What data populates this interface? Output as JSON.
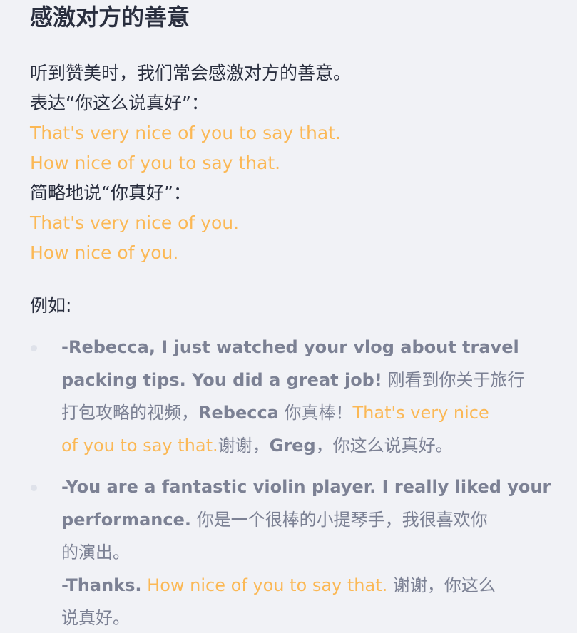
{
  "title": "感激对方的善意",
  "intro": {
    "line1": "听到赞美时，我们常会感激对方的善意。",
    "line2": "表达“你这么说真好”：",
    "phrase1": "That's very nice of you to say that.",
    "phrase2": "How nice of you to say that.",
    "line3": "简略地说“你真好”：",
    "phrase3": "That's very nice of you.",
    "phrase4": "How nice of you."
  },
  "example_label": "例如:",
  "examples": [
    {
      "en_l1": "-Rebecca, I just watched your vlog about travel",
      "en_l2": "packing tips. You did a great job!",
      "zh_l2": " 刚看到你关于旅行",
      "zh_l3a": "打包攻略的视频，",
      "en_l3": "Rebecca",
      "zh_l3b": " 你真棒！",
      "hl_l3": "That's very nice",
      "hl_l4": "of you to say that.",
      "zh_l4a": "谢谢，",
      "en_l4": "Greg",
      "zh_l4b": "，你这么说真好。"
    },
    {
      "en_l1": "-You are a fantastic violin player. I really liked your",
      "en_l2": "performance.",
      "zh_l2": " 你是一个很棒的小提琴手，我很喜欢你",
      "zh_l3": "的演出。",
      "en_l4": "-Thanks.",
      "hl_l4": " How nice of you to say that.",
      "zh_l4": " 谢谢，你这么",
      "zh_l5": "说真好。"
    }
  ],
  "colors": {
    "text": "#2a2f3f",
    "accent": "#fbb855",
    "muted": "#7c8194",
    "background": "#f1f2f6",
    "bullet": "#dfe2ea"
  }
}
